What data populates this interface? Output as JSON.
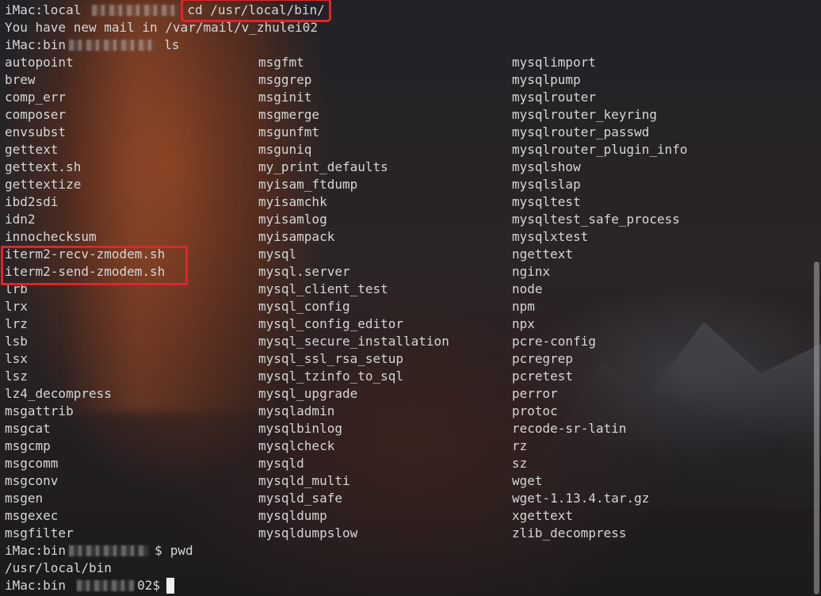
{
  "prompt_host": "iMac:local",
  "prompt_host_bin": "iMac:bin",
  "command_cd": "cd /usr/local/bin/",
  "mail_notice": "You have new mail in /var/mail/v_zhulei02",
  "command_ls": "ls",
  "listing": [
    [
      "autopoint",
      "msgfmt",
      "mysqlimport"
    ],
    [
      "brew",
      "msggrep",
      "mysqlpump"
    ],
    [
      "comp_err",
      "msginit",
      "mysqlrouter"
    ],
    [
      "composer",
      "msgmerge",
      "mysqlrouter_keyring"
    ],
    [
      "envsubst",
      "msgunfmt",
      "mysqlrouter_passwd"
    ],
    [
      "gettext",
      "msguniq",
      "mysqlrouter_plugin_info"
    ],
    [
      "gettext.sh",
      "my_print_defaults",
      "mysqlshow"
    ],
    [
      "gettextize",
      "myisam_ftdump",
      "mysqlslap"
    ],
    [
      "ibd2sdi",
      "myisamchk",
      "mysqltest"
    ],
    [
      "idn2",
      "myisamlog",
      "mysqltest_safe_process"
    ],
    [
      "innochecksum",
      "myisampack",
      "mysqlxtest"
    ],
    [
      "iterm2-recv-zmodem.sh",
      "mysql",
      "ngettext"
    ],
    [
      "iterm2-send-zmodem.sh",
      "mysql.server",
      "nginx"
    ],
    [
      "lrb",
      "mysql_client_test",
      "node"
    ],
    [
      "lrx",
      "mysql_config",
      "npm"
    ],
    [
      "lrz",
      "mysql_config_editor",
      "npx"
    ],
    [
      "lsb",
      "mysql_secure_installation",
      "pcre-config"
    ],
    [
      "lsx",
      "mysql_ssl_rsa_setup",
      "pcregrep"
    ],
    [
      "lsz",
      "mysql_tzinfo_to_sql",
      "pcretest"
    ],
    [
      "lz4_decompress",
      "mysql_upgrade",
      "perror"
    ],
    [
      "msgattrib",
      "mysqladmin",
      "protoc"
    ],
    [
      "msgcat",
      "mysqlbinlog",
      "recode-sr-latin"
    ],
    [
      "msgcmp",
      "mysqlcheck",
      "rz"
    ],
    [
      "msgcomm",
      "mysqld",
      "sz"
    ],
    [
      "msgconv",
      "mysqld_multi",
      "wget"
    ],
    [
      "msgen",
      "mysqld_safe",
      "wget-1.13.4.tar.gz"
    ],
    [
      "msgexec",
      "mysqldump",
      "xgettext"
    ],
    [
      "msgfilter",
      "mysqldumpslow",
      "zlib_decompress"
    ]
  ],
  "pwd_prompt_suffix": "$",
  "command_pwd": "pwd",
  "pwd_output": "/usr/local/bin",
  "last_prompt_suffix": "02$",
  "highlight_color": "#e0242a"
}
